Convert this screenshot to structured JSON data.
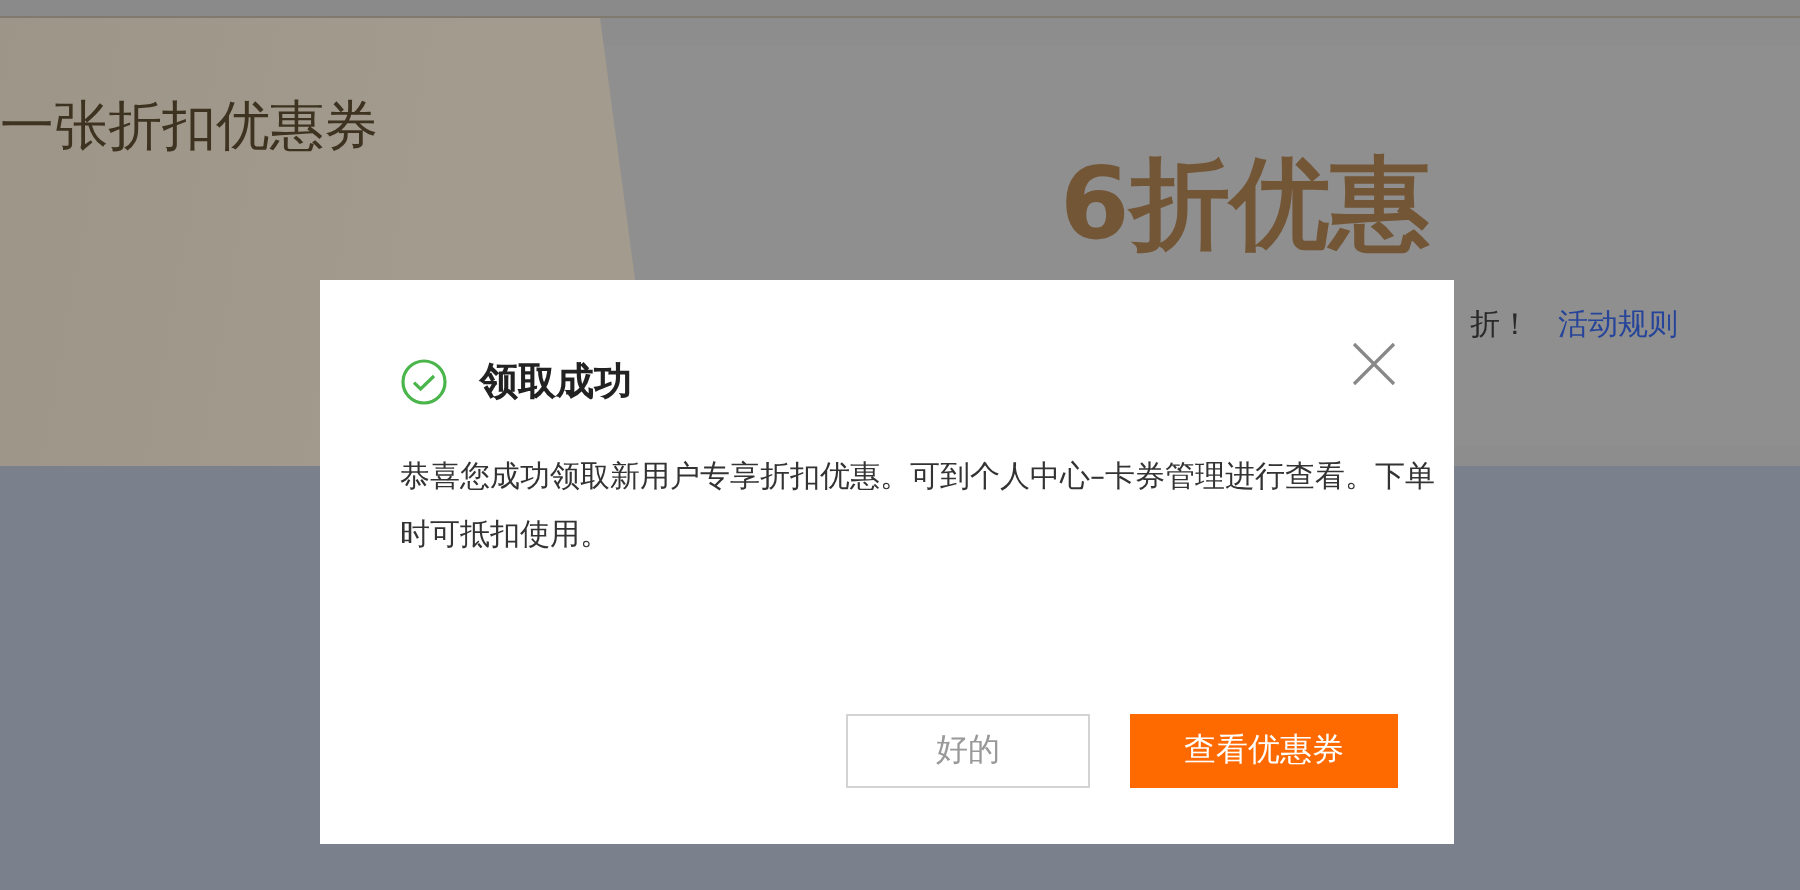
{
  "banner": {
    "heading": "一张折扣优惠券",
    "offer": "6折优惠",
    "note": "折！",
    "rules_link": "活动规则"
  },
  "dialog": {
    "kind": "success",
    "title": "领取成功",
    "message": "恭喜您成功领取新用户专享折扣优惠。可到个人中心–卡券管理进行查看。下单时可抵扣使用。",
    "buttons": [
      {
        "label": "好的",
        "kind": "secondary"
      },
      {
        "label": "查看优惠券",
        "kind": "primary"
      }
    ]
  }
}
